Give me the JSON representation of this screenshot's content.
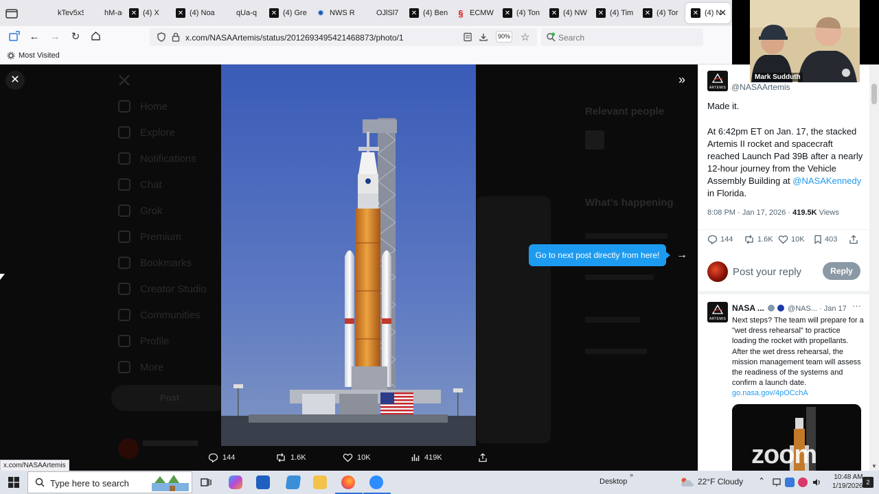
{
  "browser": {
    "tabs": [
      {
        "label": "kTev5xS",
        "favicon": "blank"
      },
      {
        "label": "hM-ao",
        "favicon": "blank"
      },
      {
        "label": "(4) X",
        "favicon": "x"
      },
      {
        "label": "(4) Noa",
        "favicon": "x"
      },
      {
        "label": "qUa-q",
        "favicon": "blank"
      },
      {
        "label": "(4) Gre",
        "favicon": "x"
      },
      {
        "label": "NWS R",
        "favicon": "nws"
      },
      {
        "label": "OJlSl7",
        "favicon": "blank"
      },
      {
        "label": "(4) Ben",
        "favicon": "x"
      },
      {
        "label": "ECMW",
        "favicon": "ecmwf"
      },
      {
        "label": "(4) Ton",
        "favicon": "x"
      },
      {
        "label": "(4) NW",
        "favicon": "x"
      },
      {
        "label": "(4) Tim",
        "favicon": "x"
      },
      {
        "label": "(4) Tor",
        "favicon": "x"
      },
      {
        "label": "(4) N",
        "favicon": "x",
        "active": true
      }
    ],
    "url": "x.com/NASAArtemis/status/2012693495421468873/photo/1",
    "zoom": "90%",
    "search_placeholder": "Search",
    "bookmark": "Most Visited",
    "status_url": "x.com/NASAArtemis"
  },
  "background_page": {
    "nav": [
      "Home",
      "Explore",
      "Notifications",
      "Chat",
      "Grok",
      "Premium",
      "Bookmarks",
      "Creator Studio",
      "Communities",
      "Profile",
      "More"
    ],
    "post_button": "Post",
    "relevant_people": "Relevant people",
    "whats_happening": "What's happening"
  },
  "media": {
    "next_hint": "Go to next post directly from here!",
    "actions": {
      "replies": "144",
      "reposts": "1.6K",
      "likes": "10K",
      "views": "419K"
    }
  },
  "post": {
    "handle": "@NASAArtemis",
    "logo_text": "ARTEMIS",
    "headline": "Made it.",
    "body_1": "At 6:42pm ET on Jan. 17, the stacked Artemis II rocket and spacecraft reached Launch Pad 39B after a nearly 12-hour journey from the Vehicle Assembly Building at ",
    "body_link": "@NASAKennedy",
    "body_2": " in Florida.",
    "meta_time": "8:08 PM · Jan 17, 2026 · ",
    "meta_views": "419.5K",
    "meta_views_label": " Views",
    "actions": {
      "replies": "144",
      "reposts": "1.6K",
      "likes": "10K",
      "bookmarks": "403"
    },
    "reply_placeholder": "Post your reply",
    "reply_button": "Reply",
    "colors": {
      "link": "#1d9bf0",
      "reply_button": "#8b98a5"
    }
  },
  "reply_post": {
    "name": "NASA ...",
    "handle": "@NAS...",
    "date": "· Jan 17",
    "more": "···",
    "body": "Next steps? The team will prepare for a \"wet dress rehearsal\" to practice loading the rocket with propellants. After the wet dress rehearsal, the mission management team will assess the readiness of the systems and confirm a launch date. ",
    "link": "go.nasa.gov/4pOCchA"
  },
  "webcam": {
    "name": "Mark Sudduth"
  },
  "zoom_watermark": "zoom",
  "taskbar": {
    "search": "Type here to search",
    "desktop": "Desktop",
    "weather": "22°F  Cloudy",
    "time": "10:48 AM",
    "date": "1/19/2026"
  }
}
